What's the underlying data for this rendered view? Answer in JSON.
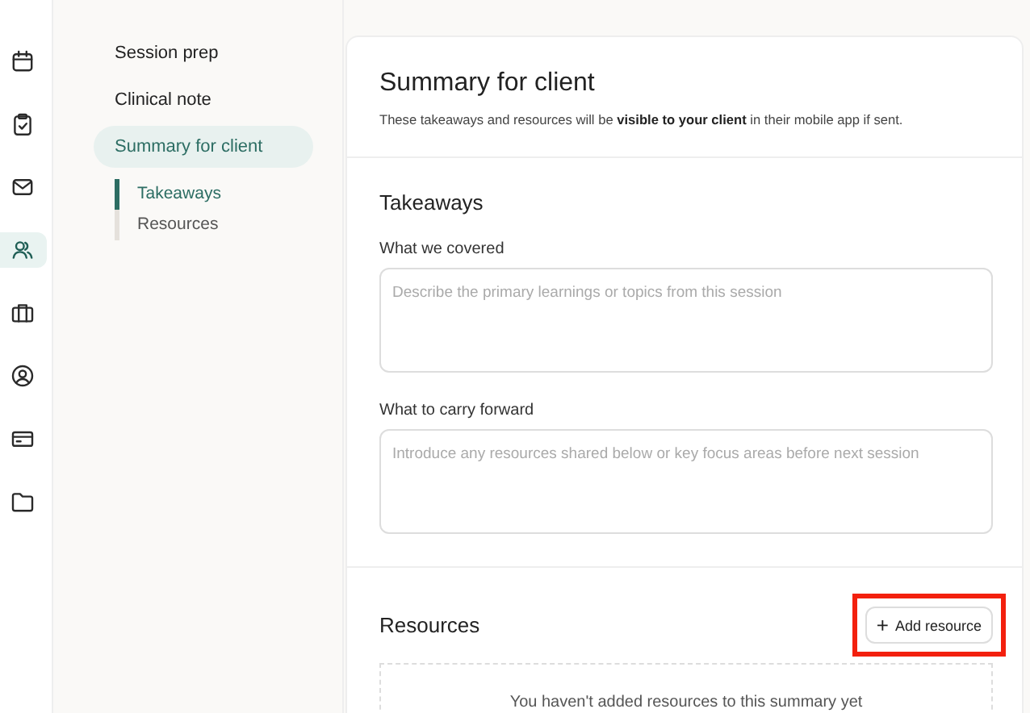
{
  "rail": {
    "items": [
      {
        "kind": "calendar",
        "selected": false
      },
      {
        "kind": "clipboard",
        "selected": false
      },
      {
        "kind": "mail",
        "selected": false
      },
      {
        "kind": "people",
        "selected": true
      },
      {
        "kind": "briefcase",
        "selected": false
      },
      {
        "kind": "user",
        "selected": false
      },
      {
        "kind": "card",
        "selected": false
      },
      {
        "kind": "folder",
        "selected": false
      }
    ]
  },
  "nav": {
    "items": [
      {
        "label": "Session prep",
        "selected": false
      },
      {
        "label": "Clinical note",
        "selected": false
      },
      {
        "label": "Summary for client",
        "selected": true
      }
    ],
    "sub_items": [
      {
        "label": "Takeaways",
        "selected": true
      },
      {
        "label": "Resources",
        "selected": false
      }
    ]
  },
  "summary": {
    "title": "Summary for client",
    "subtitle": "These takeaways and resources will be **visible to your client** in their mobile app if sent.",
    "takeaways": {
      "heading": "Takeaways",
      "fields": [
        {
          "label": "What we covered",
          "placeholder": "Describe the primary learnings or topics from this session"
        },
        {
          "label": "What to carry forward",
          "placeholder": "Introduce any resources shared below or key focus areas before next session"
        }
      ]
    },
    "resources": {
      "heading": "Resources",
      "button": {
        "icon": "+",
        "label": "Add resource",
        "highlighted": true
      },
      "empty_text": "You haven't added resources to this summary yet"
    }
  }
}
